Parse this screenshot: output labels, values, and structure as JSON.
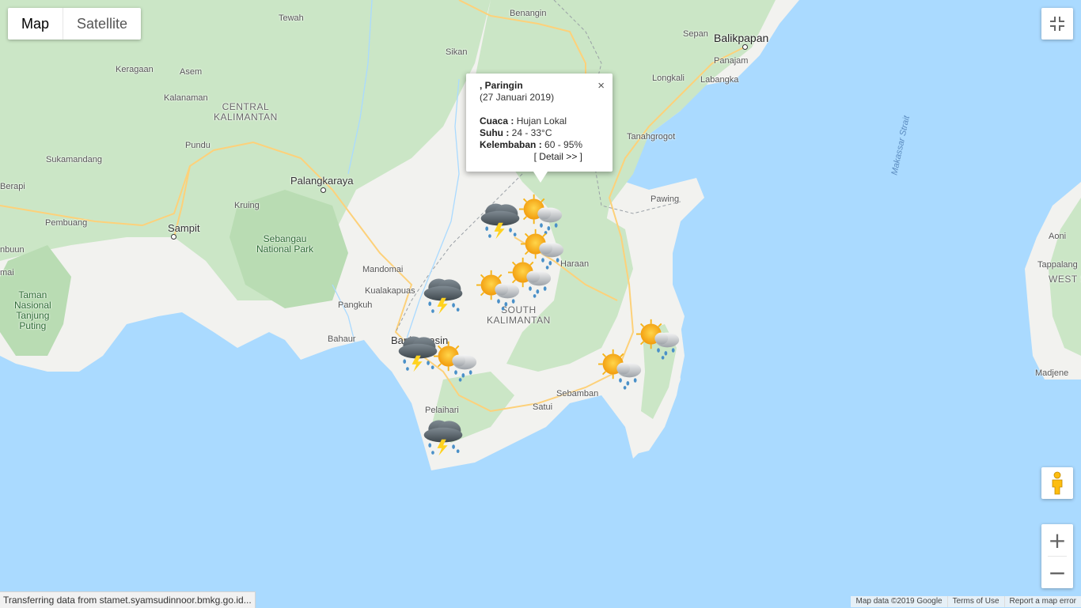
{
  "map_type": {
    "map_label": "Map",
    "satellite_label": "Satellite",
    "active": "Map"
  },
  "controls": {
    "fullscreen_icon": "exit-fullscreen-icon",
    "pegman_icon": "pegman-icon",
    "zoom_in": "+",
    "zoom_out": "−"
  },
  "places": {
    "balikpapan": "Balikpapan",
    "sepan": "Sepan",
    "panajam": "Panajam",
    "longkali": "Longkali",
    "labangka": "Labangka",
    "tanahgrogot": "Tanahgrogot",
    "pawing": "Pawing",
    "makassar_strait": "Makassar Strait",
    "aoni": "Aoni",
    "tappalang": "Tappalang",
    "west_s": "WEST S",
    "madjene": "Madjene",
    "benangin": "Benangin",
    "tewah": "Tewah",
    "sikan": "Sikan",
    "keragaan": "Keragaan",
    "asem": "Asem",
    "kalanaman": "Kalanaman",
    "central_kalimantan_1": "CENTRAL",
    "central_kalimantan_2": "KALIMANTAN",
    "pundu": "Pundu",
    "sukamandang": "Sukamandang",
    "berapi": "Berapi",
    "palangkaraya": "Palangkaraya",
    "kruing": "Kruing",
    "pembuang": "Pembuang",
    "sampit": "Sampit",
    "sebangau_1": "Sebangau",
    "sebangau_2": "National Park",
    "buun": "nbuun",
    "mai": "mai",
    "taman_1": "Taman",
    "taman_2": "Nasional",
    "taman_3": "Tanjung",
    "taman_4": "Puting",
    "mandomai": "Mandomai",
    "kualakapuas": "Kualakapuas",
    "pangkuh": "Pangkuh",
    "bahaur": "Bahaur",
    "banjarmasin": "Banjarmasin",
    "haraan": "Haraan",
    "south_kalimantan_1": "SOUTH",
    "south_kalimantan_2": "KALIMANTAN",
    "sebamban": "Sebamban",
    "satui": "Satui",
    "pelaihari": "Pelaihari"
  },
  "info_window": {
    "title": ", Paringin",
    "date": "(27 Januari 2019)",
    "cuaca_label": "Cuaca :",
    "cuaca_value": " Hujan Lokal",
    "suhu_label": "Suhu :",
    "suhu_value": " 24 - 33°C",
    "kelembaban_label": "Kelembaban :",
    "kelembaban_value": " 60 - 95%",
    "detail_link": "[ Detail >> ]",
    "close": "×"
  },
  "weather_markers": [
    {
      "name": "thunderstorm-marker-1",
      "icon": "thunderstorm-icon"
    },
    {
      "name": "sunny-rain-marker-1",
      "icon": "sun-rain-icon"
    },
    {
      "name": "sunny-rain-marker-2",
      "icon": "sun-rain-icon"
    },
    {
      "name": "sunny-rain-marker-3",
      "icon": "sun-rain-icon"
    },
    {
      "name": "sunny-rain-marker-4",
      "icon": "sun-rain-icon"
    },
    {
      "name": "thunderstorm-marker-2",
      "icon": "thunderstorm-icon"
    },
    {
      "name": "thunderstorm-marker-3",
      "icon": "thunderstorm-icon"
    },
    {
      "name": "sunny-rain-marker-5",
      "icon": "sun-rain-icon"
    },
    {
      "name": "sunny-rain-marker-6",
      "icon": "sun-rain-icon"
    },
    {
      "name": "sunny-rain-marker-7",
      "icon": "sun-rain-icon"
    },
    {
      "name": "thunderstorm-marker-4",
      "icon": "thunderstorm-icon"
    }
  ],
  "status_bar": "Transferring data from stamet.syamsudinnoor.bmkg.go.id...",
  "footer": {
    "map_data": "Map data ©2019 Google",
    "terms": "Terms of Use",
    "report": "Report a map error"
  },
  "colors": {
    "water": "#aadaff",
    "land": "#f2f2ef",
    "forest": "#cbe6c6",
    "road": "#fdd17a",
    "sun": "#f8b81c",
    "cloud": "#9aa0a6",
    "storm": "#4b555c"
  }
}
